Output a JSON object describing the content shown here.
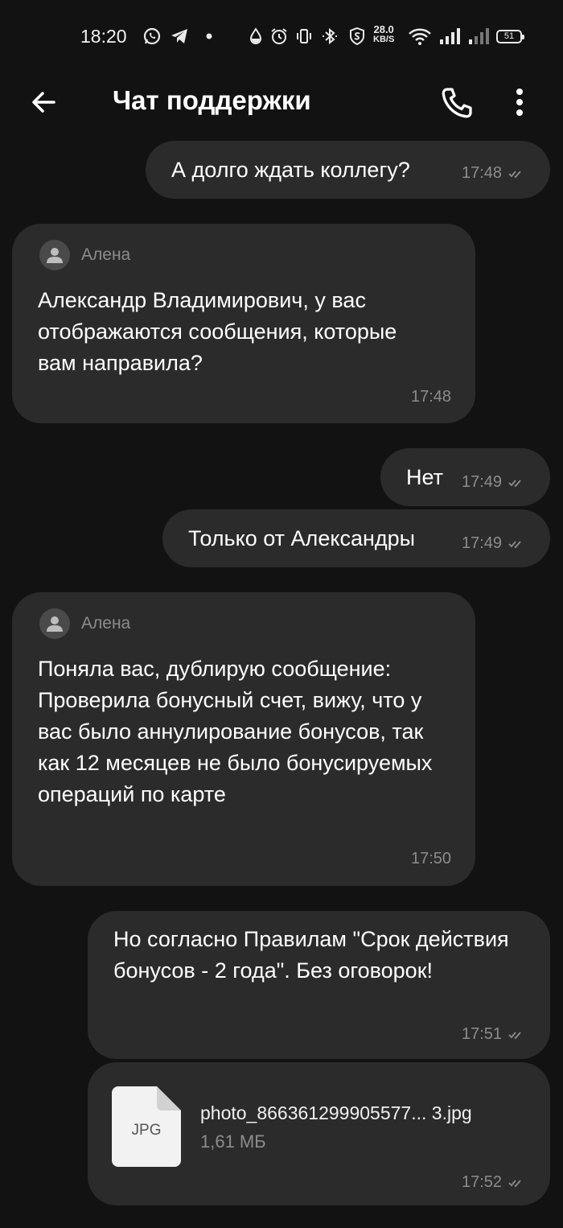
{
  "status_bar": {
    "time": "18:20",
    "net_speed_value": "28.0",
    "net_speed_unit": "KB/S",
    "battery": "51",
    "icons": [
      "whatsapp-icon",
      "telegram-icon",
      "dot-icon",
      "drop-icon",
      "alarm-icon",
      "vibrate-icon",
      "bluetooth-icon",
      "shield-icon",
      "wifi-icon",
      "signal-icon",
      "signal-weak-icon",
      "battery-icon"
    ]
  },
  "header": {
    "title": "Чат поддержки",
    "icons": [
      "back-arrow-icon",
      "phone-icon",
      "more-vert-icon"
    ]
  },
  "messages": [
    {
      "dir": "out",
      "text": "А долго ждать коллегу?",
      "time": "17:48",
      "read": true
    },
    {
      "dir": "in",
      "sender": "Алена",
      "text": "Александр Владимирович, у вас отображаются сообщения, которые вам направила?",
      "time": "17:48"
    },
    {
      "dir": "out",
      "text": "Нет",
      "time": "17:49",
      "read": true
    },
    {
      "dir": "out",
      "text": "Только от Александры",
      "time": "17:49",
      "read": true
    },
    {
      "dir": "in",
      "sender": "Алена",
      "text": "Поняла вас, дублирую сообщение: Проверила бонусный счет, вижу, что у вас было аннулирование бонусов, так как 12 месяцев не было бонусируемых операций по карте",
      "time": "17:50"
    },
    {
      "dir": "out",
      "text": "Но согласно Правилам \"Срок действия бонусов - 2 года\". Без оговорок!",
      "time": "17:51",
      "read": true
    },
    {
      "dir": "out",
      "type": "file",
      "file_type": "JPG",
      "file_name": "photo_866361299905577... 3.jpg",
      "file_size": "1,61 МБ",
      "time": "17:52",
      "read": true
    }
  ],
  "colors": {
    "background": "#121212",
    "bubble": "#2b2b2b",
    "meta_text": "#8c8c8c",
    "text": "#ffffff"
  }
}
